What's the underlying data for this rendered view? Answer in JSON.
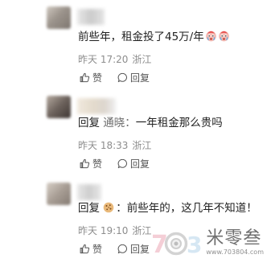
{
  "comments": [
    {
      "reply_prefix": "",
      "mention": "",
      "text": "前些年，租金投了45万/年",
      "time": "昨天 17:20",
      "location": "浙江",
      "like_label": "赞",
      "reply_label": "回复"
    },
    {
      "reply_prefix": "回复",
      "mention": "通晓：",
      "text": "一年租金那么贵吗",
      "time": "昨天 18:33",
      "location": "浙江",
      "like_label": "赞",
      "reply_label": "回复"
    },
    {
      "reply_prefix": "回复",
      "mention": "",
      "text": "：前些年的，这几年不知道！",
      "time": "昨天 19:10",
      "location": "浙江",
      "like_label": "赞",
      "reply_label": "回复"
    }
  ],
  "watermark": {
    "brand": "米零叁",
    "url": "www.703804.com"
  },
  "colors": {
    "text": "#1f1f1f",
    "meta": "#8d8d8d",
    "mention": "#6b6b6b",
    "watermark": "#6f6f6f"
  },
  "icons": {
    "emoji": "face-with-tears-icon",
    "cookie": "cookie-avatar-icon",
    "like": "thumb-up-icon",
    "reply": "comment-bubble-icon"
  }
}
